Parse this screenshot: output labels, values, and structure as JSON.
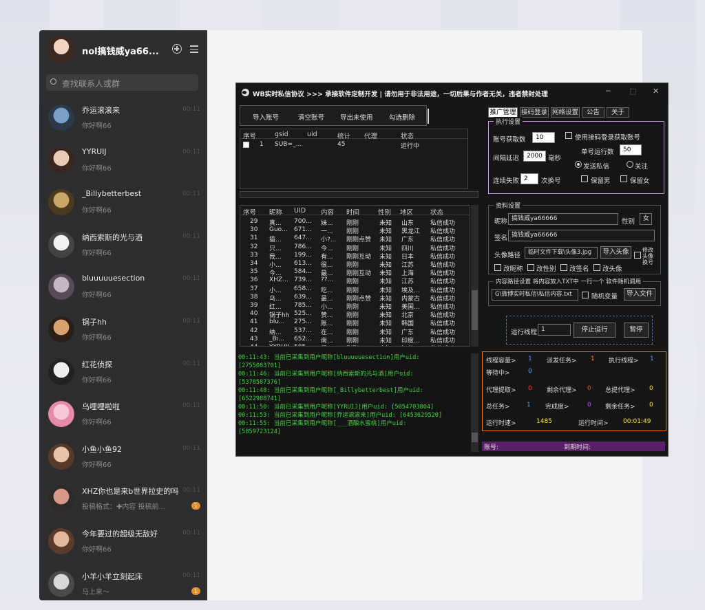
{
  "sidebar": {
    "profile_name": "nol搞钱威ya66...",
    "search_placeholder": "查找联系人或群",
    "conversations": [
      {
        "name": "乔运滚滚来",
        "msg": "你好啊66",
        "time": "00:11",
        "badge": ""
      },
      {
        "name": "YYRUIJ",
        "msg": "你好啊66",
        "time": "00:11",
        "badge": ""
      },
      {
        "name": "_Billybetterbest",
        "msg": "你好啊66",
        "time": "00:11",
        "badge": ""
      },
      {
        "name": "纳西索斯的光与酒",
        "msg": "你好啊66",
        "time": "00:11",
        "badge": ""
      },
      {
        "name": "bluuuuuesection",
        "msg": "你好啊66",
        "time": "00:11",
        "badge": ""
      },
      {
        "name": "锅子hh",
        "msg": "你好啊66",
        "time": "00:11",
        "badge": ""
      },
      {
        "name": "红花侦探",
        "msg": "你好啊66",
        "time": "00:11",
        "badge": ""
      },
      {
        "name": "乌哩哩啦啦",
        "msg": "你好啊66",
        "time": "00:11",
        "badge": ""
      },
      {
        "name": "小鱼小鱼92",
        "msg": "你好啊66",
        "time": "00:11",
        "badge": ""
      },
      {
        "name": "XHZ你也是来b世界拉史的吗",
        "msg": "投稿格式：✚内容 投稿前...",
        "time": "00:11",
        "badge": "1"
      },
      {
        "name": "今年要过的超级无敌好",
        "msg": "你好啊66",
        "time": "00:11",
        "badge": ""
      },
      {
        "name": "小羊小羊立刻起床",
        "msg": "马上来～",
        "time": "00:11",
        "badge": "1"
      }
    ]
  },
  "app": {
    "title": "WB实时私信协议    >>>  承接软件定制开发   |   请勿用于非法用途，一切后果与作者无关，违者禁封处理",
    "toolbar": [
      "导入账号",
      "清空账号",
      "导出未使用",
      "勾选删除"
    ],
    "acct_headers": [
      "序号",
      "gsid",
      "uid",
      "统计",
      "代理",
      "状态"
    ],
    "acct_rows": [
      [
        "1",
        "SUB=_...",
        "",
        "45",
        "",
        "运行中"
      ]
    ],
    "msg_headers": [
      "序号",
      "昵称",
      "UID",
      "内容",
      "时间",
      "性别",
      "地区",
      "状态"
    ],
    "msg_rows": [
      [
        "29",
        "真...",
        "700...",
        "妹...",
        "刚刚",
        "未知",
        "山东",
        "私信成功"
      ],
      [
        "30",
        "Guo...",
        "671...",
        "一...",
        "刚刚",
        "未知",
        "黑龙江",
        "私信成功"
      ],
      [
        "31",
        "猫...",
        "647...",
        "小?...",
        "刚刚点赞",
        "未知",
        "广东",
        "私信成功"
      ],
      [
        "32",
        "只...",
        "786...",
        "今...",
        "刚刚",
        "未知",
        "四川",
        "私信成功"
      ],
      [
        "33",
        "我...",
        "199...",
        "有...",
        "刚刚互动",
        "未知",
        "日本",
        "私信成功"
      ],
      [
        "34",
        "小...",
        "613...",
        "很...",
        "刚刚",
        "未知",
        "江苏",
        "私信成功"
      ],
      [
        "35",
        "今...",
        "584...",
        "最...",
        "刚刚互动",
        "未知",
        "上海",
        "私信成功"
      ],
      [
        "36",
        "XHZ...",
        "739...",
        "??...",
        "刚刚",
        "未知",
        "江苏",
        "私信成功"
      ],
      [
        "37",
        "小...",
        "658...",
        "吃...",
        "刚刚",
        "未知",
        "埃及...",
        "私信成功"
      ],
      [
        "38",
        "乌...",
        "639...",
        "最...",
        "刚刚点赞",
        "未知",
        "内蒙古",
        "私信成功"
      ],
      [
        "39",
        "红...",
        "785...",
        "小...",
        "刚刚",
        "未知",
        "美国...",
        "私信成功"
      ],
      [
        "40",
        "锅子hh",
        "525...",
        "赞...",
        "刚刚",
        "未知",
        "北京",
        "私信成功"
      ],
      [
        "41",
        "blu...",
        "275...",
        "账...",
        "刚刚",
        "未知",
        "韩国",
        "私信成功"
      ],
      [
        "42",
        "纳...",
        "537...",
        "在...",
        "刚刚",
        "未知",
        "广东",
        "私信成功"
      ],
      [
        "43",
        "_Bi...",
        "652...",
        "南...",
        "刚刚",
        "未知",
        "印度...",
        "私信成功"
      ],
      [
        "44",
        "YYRUIJ",
        "585...",
        "很...",
        "刚刚",
        "未知",
        "江苏",
        "私信成功"
      ]
    ],
    "log": [
      "00:11:43: 当前已采集到用户昵称[bluuuuuesection]用户uid:",
      "[2755083701]",
      "00:11:46: 当前已采集到用户昵称[纳西索斯的光与酒]用户uid:",
      "[5378587376]",
      "00:11:48: 当前已采集到用户昵称[_Billybetterbest]用户uid:",
      "[6522988741]",
      "00:11:50: 当前已采集到用户昵称[YYRUIJ]用户uid: [5054703804]",
      "00:11:53: 当前已采集到用户昵称[乔运滚滚来]用户uid: [6453629520]",
      "00:11:55: 当前已采集到用户昵称[___酒酿水蜜桃]用户uid:",
      "[5859723124]"
    ],
    "tabs": [
      "推广管理",
      "接码登录",
      "网络设置",
      "公告",
      "关于"
    ],
    "exec": {
      "legend": "执行设置",
      "acct_fetch_label": "账号获取数",
      "acct_fetch": "10",
      "use_code_login": "使用接码登录获取账号",
      "single_run_label": "单号运行数",
      "single_run": "50",
      "interval_label": "间隔延迟",
      "interval": "2000",
      "interval_unit": "毫秒",
      "send_msg": "发送私信",
      "follow": "关注",
      "fail_label": "连续失败",
      "fail": "2",
      "fail_unit": "次换号",
      "keep_male": "保留男",
      "keep_female": "保留女"
    },
    "profile": {
      "legend": "资料设置",
      "nick_label": "昵称",
      "nick": "搞钱威ya66666",
      "gender_label": "性别",
      "gender": "女",
      "sign_label": "签名",
      "sign": "搞钱威ya66666",
      "avatar_label": "头像路径",
      "avatar_path": "临时文件下载\\头像3.jpg",
      "import_avatar": "导入头像",
      "change_avatar": "修改头像换号",
      "chk_nick": "改昵称",
      "chk_gender": "改性别",
      "chk_sign": "改签名",
      "chk_avatar": "改头像"
    },
    "content": {
      "legend": "内容路径设置  将内容放入TXT中 一行一个 软件随机调用",
      "path": "G\\微博实时私信\\私信内容.txt",
      "random_var": "随机变量",
      "import_file": "导入文件"
    },
    "run": {
      "thread_label": "运行线程",
      "thread": "1",
      "stop": "停止运行",
      "pause": "暂停"
    },
    "stats": {
      "thread_cap_label": "线程容量>",
      "thread_cap": "1",
      "dispatch_label": "派发任务>",
      "dispatch": "1",
      "exec_thread_label": "执行线程>",
      "exec_thread": "1",
      "waiting_label": "等待中>",
      "waiting": "0",
      "proxy_fetch_label": "代理提取>",
      "proxy_fetch": "0",
      "proxy_left_label": "剩余代理>",
      "proxy_left": "0",
      "proxy_total_label": "总提代理>",
      "proxy_total": "0",
      "total_task_label": "总任务>",
      "total_task": "1",
      "completed_label": "完成度>",
      "completed": "0",
      "remaining_label": "剩余任务>",
      "remaining": "0",
      "speed_label": "运行时速>",
      "speed": "1485",
      "runtime_label": "运行时间>",
      "runtime": "00:01:49"
    },
    "footer": {
      "account_label": "账号:",
      "expire_label": "到期时间:"
    }
  },
  "colors": {
    "accent_purple": "#5b1f6a",
    "stat_blue": "#4ea8ff",
    "stat_orange": "#ff8a3d",
    "stat_red": "#ff3b3b",
    "stat_purple": "#b04fff",
    "stat_yellow": "#ffe23a",
    "log_green": "#3ed33e"
  }
}
